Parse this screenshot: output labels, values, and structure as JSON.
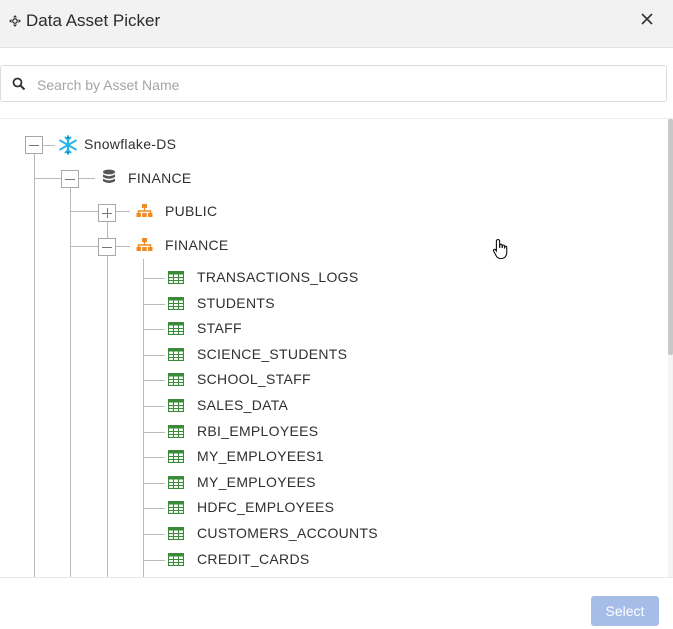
{
  "header": {
    "title": "Data Asset Picker",
    "picker_icon": "move-arrows-icon",
    "close_icon": "close-icon"
  },
  "search": {
    "placeholder": "Search by Asset Name",
    "value": "",
    "icon": "search-icon"
  },
  "tree": {
    "datasource": {
      "label": "Snowflake-DS",
      "icon": "snowflake-icon",
      "expanded": true
    },
    "database": {
      "label": "FINANCE",
      "icon": "database-icon",
      "expanded": true
    },
    "schemas": [
      {
        "label": "PUBLIC",
        "icon": "schema-icon",
        "expanded": false
      },
      {
        "label": "FINANCE",
        "icon": "schema-icon",
        "expanded": true
      }
    ],
    "tables": [
      "TRANSACTIONS_LOGS",
      "STUDENTS",
      "STAFF",
      "SCIENCE_STUDENTS",
      "SCHOOL_STAFF",
      "SALES_DATA",
      "RBI_EMPLOYEES",
      "MY_EMPLOYEES1",
      "MY_EMPLOYEES",
      "HDFC_EMPLOYEES",
      "CUSTOMERS_ACCOUNTS",
      "CREDIT_CARDS"
    ],
    "table_icon": "table-icon"
  },
  "footer": {
    "select_label": "Select"
  },
  "colors": {
    "snowflake": "#29b5e8",
    "schema": "#f08a24",
    "table": "#3a8a3a",
    "database": "#555555",
    "select_button": "#a6bde8"
  }
}
